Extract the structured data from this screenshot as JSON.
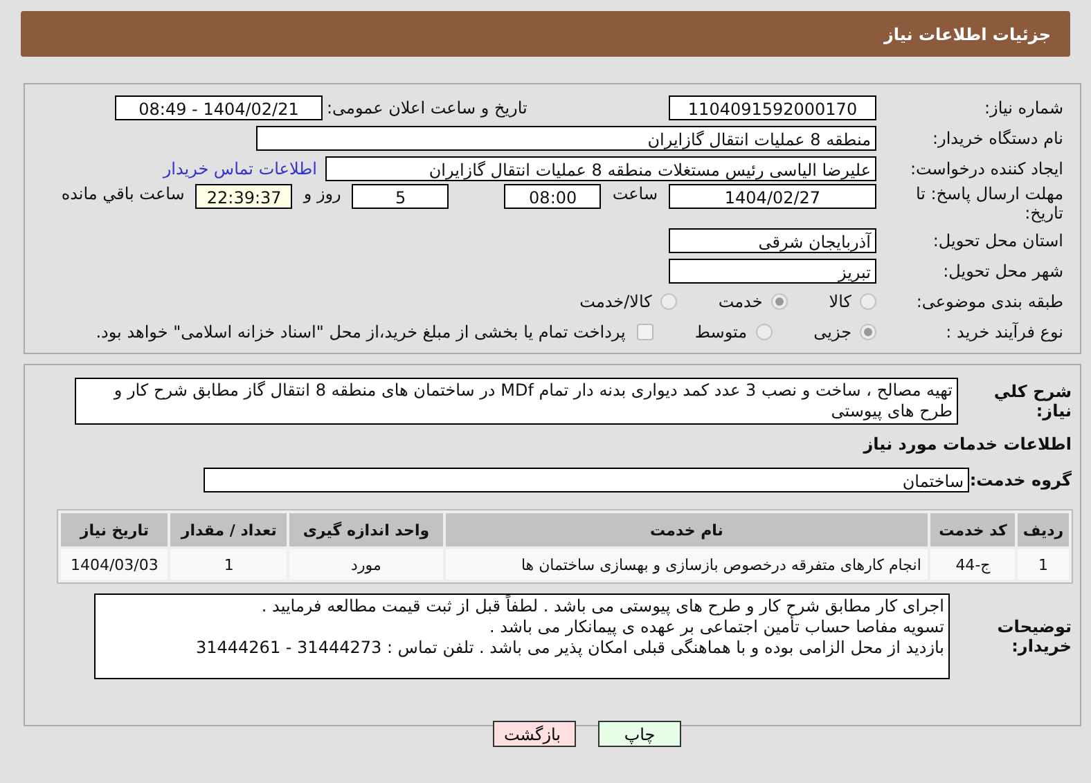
{
  "page_title": "جزئیات اطلاعات نیاز",
  "need_number": {
    "label": "شماره نیاز:",
    "value": "1104091592000170"
  },
  "announce": {
    "label": "تاریخ و ساعت اعلان عمومی:",
    "value": "1404/02/21 - 08:49"
  },
  "buyer_org": {
    "label": "نام دستگاه خریدار:",
    "value": "منطقه 8 عملیات انتقال گازایران"
  },
  "creator": {
    "label": "ایجاد کننده درخواست:",
    "value": "علیرضا الیاسی رئیس مستغلات منطقه 8 عملیات انتقال گازایران",
    "link": "اطلاعات تماس خریدار"
  },
  "deadline": {
    "label": "مهلت ارسال پاسخ: تا تاریخ:",
    "date": "1404/02/27",
    "time_label": "ساعت",
    "time": "08:00",
    "days": "5",
    "days_label": "روز و",
    "remaining": "22:39:37",
    "remaining_label": "ساعت باقي مانده"
  },
  "province": {
    "label": "استان محل تحویل:",
    "value": "آذربایجان شرقی"
  },
  "city": {
    "label": "شهر محل تحویل:",
    "value": "تبریز"
  },
  "category": {
    "label": "طبقه بندی موضوعی:",
    "options": [
      {
        "label": "کالا",
        "selected": false
      },
      {
        "label": "خدمت",
        "selected": true
      },
      {
        "label": "کالا/خدمت",
        "selected": false
      }
    ]
  },
  "process": {
    "label": "نوع فرآیند خرید :",
    "options": [
      {
        "label": "جزیی",
        "selected": true
      },
      {
        "label": "متوسط",
        "selected": false
      }
    ],
    "treasury": {
      "label": "پرداخت تمام یا بخشی از مبلغ خرید،از محل \"اسناد خزانه اسلامی\" خواهد بود.",
      "checked": false
    }
  },
  "summary": {
    "label": "شرح کلي نياز:",
    "value": "تهیه مصالح ، ساخت و نصب 3 عدد کمد دیواری بدنه دار تمام MDf در ساختمان های منطقه 8 انتقال گاز مطابق شرح کار و طرح های پیوستی"
  },
  "services_heading": "اطلاعات خدمات مورد نیاز",
  "service_group": {
    "label": "گروه خدمت:",
    "value": "ساختمان"
  },
  "table": {
    "columns": [
      "ردیف",
      "کد خدمت",
      "نام خدمت",
      "واحد اندازه گیری",
      "تعداد / مقدار",
      "تاریخ نیاز"
    ],
    "rows": [
      [
        "1",
        "ج-44",
        "انجام کارهای متفرقه درخصوص بازسازی و بهسازی ساختمان ها",
        "مورد",
        "1",
        "1404/03/03"
      ]
    ]
  },
  "buyer_notes": {
    "label": "توضیحات خریدار:",
    "lines": [
      "اجرای کار مطابق شرح کار و طرح های پیوستی می باشد . لطفاً قبل از ثبت قیمت مطالعه فرمایید .",
      "تسویه مفاصا حساب تأمین اجتماعی بر عهده ی پیمانکار می باشد .",
      "بازدید از محل الزامی بوده و با هماهنگی قبلی امکان پذیر می باشد . تلفن تماس : 31444273 - 31444261"
    ]
  },
  "buttons": [
    {
      "label": "چاپ",
      "kind": "print"
    },
    {
      "label": "بازگشت",
      "kind": "back"
    }
  ]
}
